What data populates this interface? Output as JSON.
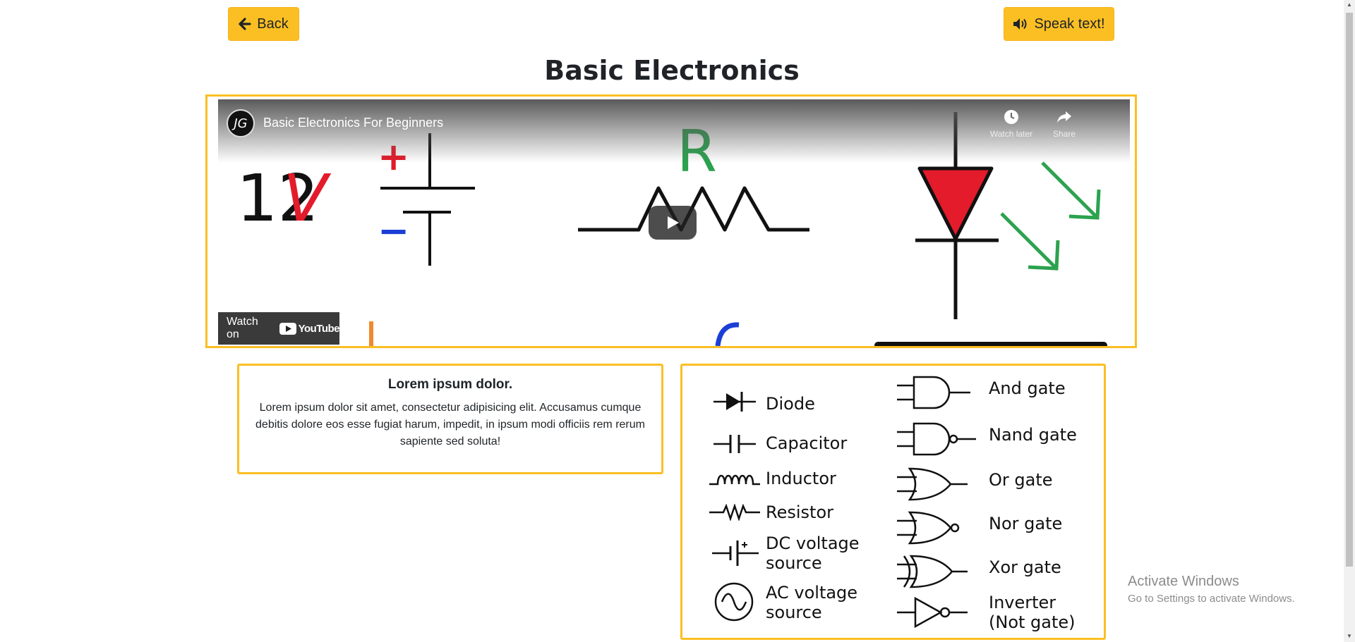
{
  "header": {
    "back_label": "Back",
    "speak_label": "Speak text!",
    "title": "Basic Electronics"
  },
  "video": {
    "channel_initials": "JG",
    "title": "Basic Electronics For Beginners",
    "watch_later_label": "Watch later",
    "share_label": "Share",
    "watch_on_label": "Watch on",
    "youtube_label": "YouTube",
    "frame_text_voltage": "12V",
    "frame_text_plus": "+",
    "frame_text_minus": "−",
    "frame_text_r": "R"
  },
  "lorem": {
    "heading": "Lorem ipsum dolor.",
    "body": "Lorem ipsum dolor sit amet, consectetur adipisicing elit. Accusamus cumque debitis dolore eos esse fugiat harum, impedit, in ipsum modi officiis rem rerum sapiente sed soluta!"
  },
  "symbols": {
    "left": [
      "Diode",
      "Capacitor",
      "Inductor",
      "Resistor",
      "DC voltage source",
      "AC voltage source"
    ],
    "right": [
      "And gate",
      "Nand gate",
      "Or gate",
      "Nor gate",
      "Xor gate",
      "Inverter (Not gate)"
    ]
  },
  "watermark": {
    "line1": "Activate Windows",
    "line2": "Go to Settings to activate Windows."
  },
  "colors": {
    "accent": "#fbbf24",
    "red": "#e31b2a",
    "green": "#2ca24f",
    "blue": "#1b3fd6"
  }
}
